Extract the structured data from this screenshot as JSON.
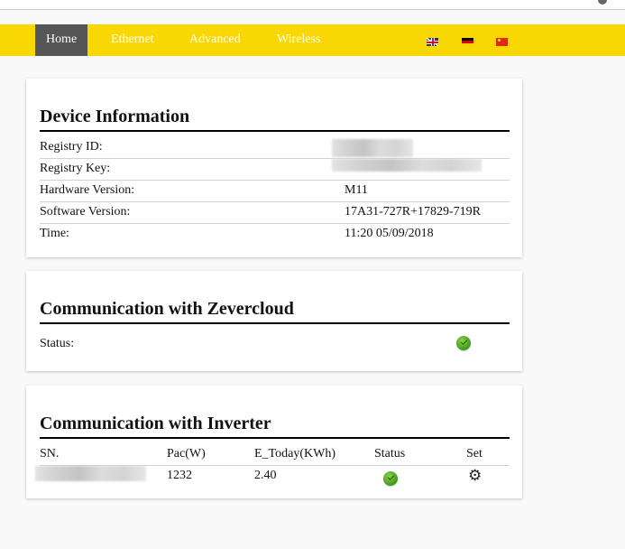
{
  "nav": {
    "items": [
      {
        "label": "Home",
        "active": true
      },
      {
        "label": "Ethernet",
        "active": false
      },
      {
        "label": "Advanced",
        "active": false
      },
      {
        "label": "Wireless",
        "active": false
      }
    ],
    "languages": [
      {
        "icon": "uk-flag-icon",
        "name": "English"
      },
      {
        "icon": "germany-flag-icon",
        "name": "German"
      },
      {
        "icon": "china-flag-icon",
        "name": "Chinese"
      }
    ]
  },
  "device_info": {
    "title": "Device Information",
    "rows": [
      {
        "label": "Registry ID:",
        "value": "",
        "redacted": true
      },
      {
        "label": "Registry Key:",
        "value": "",
        "redacted": true
      },
      {
        "label": "Hardware Version:",
        "value": "M11"
      },
      {
        "label": "Software Version:",
        "value": "17A31-727R+17829-719R"
      },
      {
        "label": "Time:",
        "value": "11:20 05/09/2018"
      }
    ]
  },
  "zevercloud": {
    "title": "Communication with Zevercloud",
    "status_label": "Status:",
    "status_icon": "check-ok-icon",
    "status": "ok"
  },
  "inverter": {
    "title": "Communication with Inverter",
    "columns": [
      "SN.",
      "Pac(W)",
      "E_Today(KWh)",
      "Status",
      "Set"
    ],
    "rows": [
      {
        "sn": "",
        "sn_redacted": true,
        "pac": "1232",
        "e_today": "2.40",
        "status": "ok",
        "status_icon": "check-ok-icon",
        "set_icon": "gear-icon"
      }
    ]
  },
  "colors": {
    "navbar": "#f8d800",
    "nav_active": "#555555",
    "page_background": "#f9f9f9",
    "status_ok": "#3c9a1a"
  }
}
